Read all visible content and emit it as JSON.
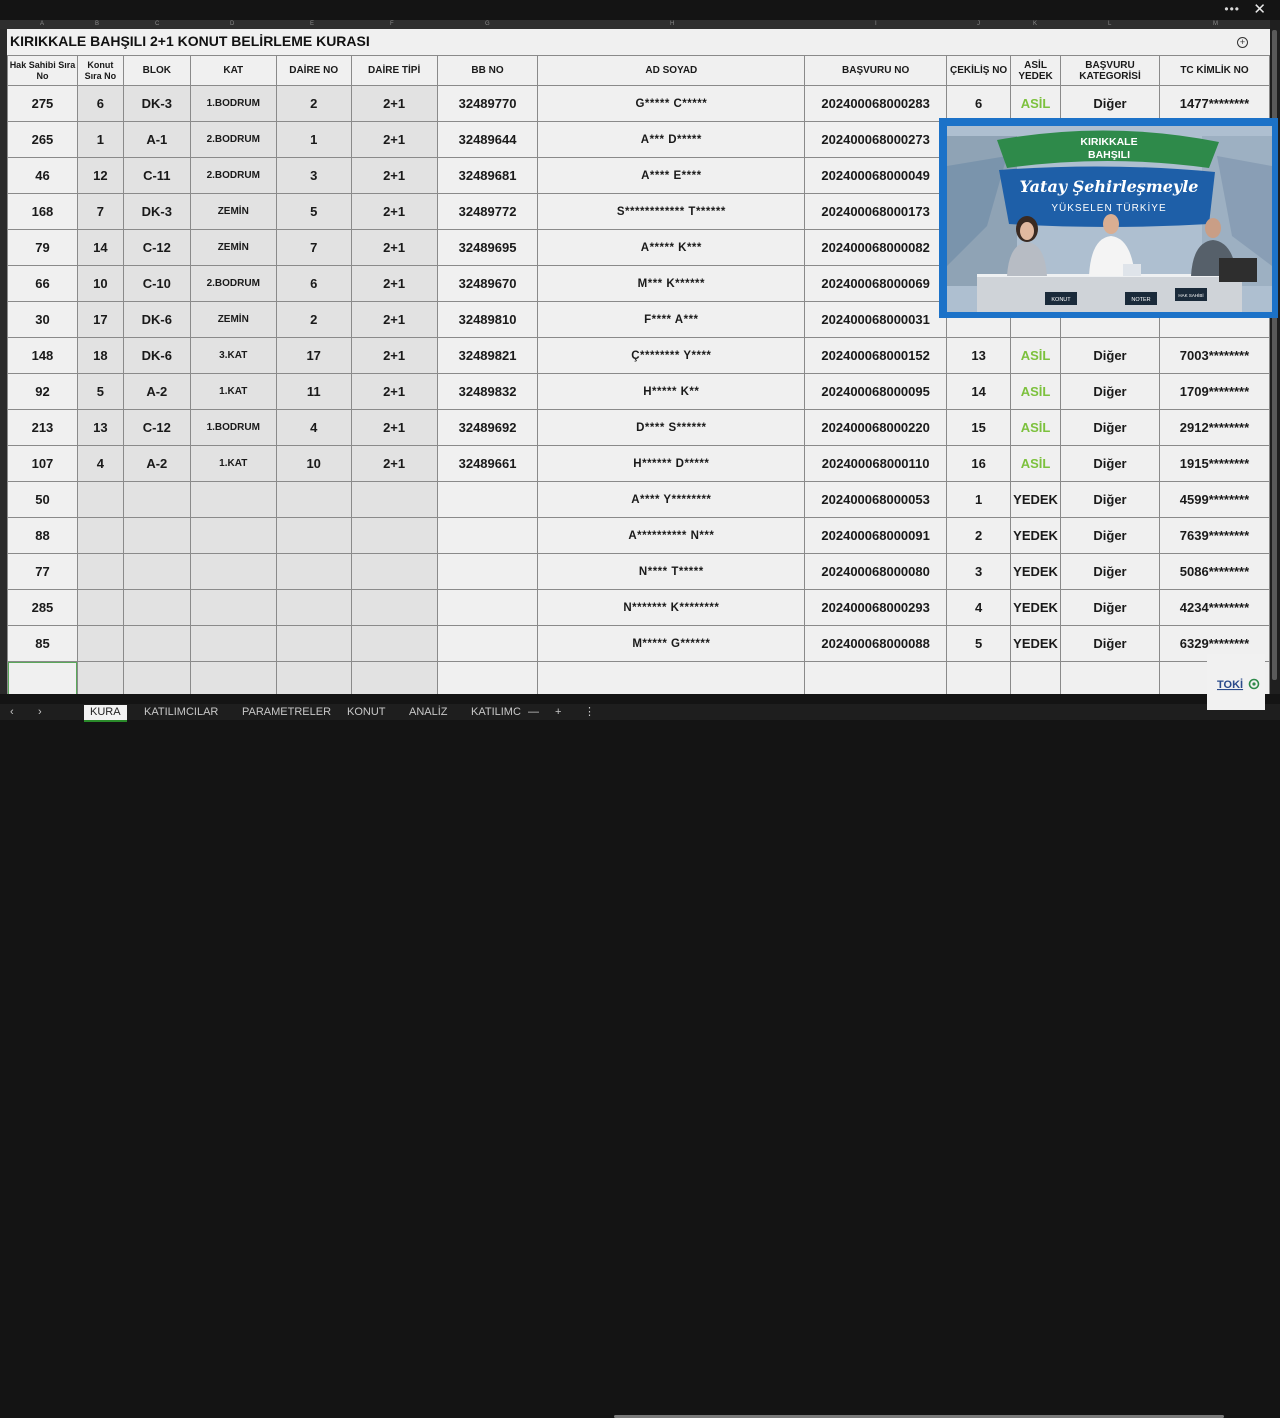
{
  "window": {
    "more": "•••",
    "close": "✕"
  },
  "col_letters": [
    "A",
    "B",
    "C",
    "D",
    "E",
    "F",
    "G",
    "H",
    "I",
    "J",
    "K",
    "L",
    "M"
  ],
  "title": "KIRIKKALE BAHŞILI 2+1 KONUT BELİRLEME KURASI",
  "headers": [
    "Hak Sahibi Sıra No",
    "Konut Sıra No",
    "BLOK",
    "KAT",
    "DAİRE NO",
    "DAİRE TİPİ",
    "BB NO",
    "AD SOYAD",
    "BAŞVURU NO",
    "ÇEKİLİŞ NO",
    "ASİL YEDEK",
    "BAŞVURU KATEGORİSİ",
    "TC KİMLİK NO"
  ],
  "rows": [
    [
      "275",
      "6",
      "DK-3",
      "1.BODRUM",
      "2",
      "2+1",
      "32489770",
      "G***** C*****",
      "202400068000283",
      "6",
      "ASİL",
      "Diğer",
      "1477********"
    ],
    [
      "265",
      "1",
      "A-1",
      "2.BODRUM",
      "1",
      "2+1",
      "32489644",
      "A*** D*****",
      "202400068000273",
      "",
      "",
      "",
      ""
    ],
    [
      "46",
      "12",
      "C-11",
      "2.BODRUM",
      "3",
      "2+1",
      "32489681",
      "A**** E****",
      "202400068000049",
      "",
      "",
      "",
      ""
    ],
    [
      "168",
      "7",
      "DK-3",
      "ZEMİN",
      "5",
      "2+1",
      "32489772",
      "S************ T******",
      "202400068000173",
      "",
      "",
      "",
      ""
    ],
    [
      "79",
      "14",
      "C-12",
      "ZEMİN",
      "7",
      "2+1",
      "32489695",
      "A***** K***",
      "202400068000082",
      "",
      "",
      "",
      ""
    ],
    [
      "66",
      "10",
      "C-10",
      "2.BODRUM",
      "6",
      "2+1",
      "32489670",
      "M*** K******",
      "202400068000069",
      "",
      "",
      "",
      ""
    ],
    [
      "30",
      "17",
      "DK-6",
      "ZEMİN",
      "2",
      "2+1",
      "32489810",
      "F**** A***",
      "202400068000031",
      "",
      "",
      "",
      ""
    ],
    [
      "148",
      "18",
      "DK-6",
      "3.KAT",
      "17",
      "2+1",
      "32489821",
      "Ç******** Y****",
      "202400068000152",
      "13",
      "ASİL",
      "Diğer",
      "7003********"
    ],
    [
      "92",
      "5",
      "A-2",
      "1.KAT",
      "11",
      "2+1",
      "32489832",
      "H***** K**",
      "202400068000095",
      "14",
      "ASİL",
      "Diğer",
      "1709********"
    ],
    [
      "213",
      "13",
      "C-12",
      "1.BODRUM",
      "4",
      "2+1",
      "32489692",
      "D**** S******",
      "202400068000220",
      "15",
      "ASİL",
      "Diğer",
      "2912********"
    ],
    [
      "107",
      "4",
      "A-2",
      "1.KAT",
      "10",
      "2+1",
      "32489661",
      "H****** D*****",
      "202400068000110",
      "16",
      "ASİL",
      "Diğer",
      "1915********"
    ],
    [
      "50",
      "",
      "",
      "",
      "",
      "",
      "",
      "A**** Y********",
      "202400068000053",
      "1",
      "YEDEK",
      "Diğer",
      "4599********"
    ],
    [
      "88",
      "",
      "",
      "",
      "",
      "",
      "",
      "A********** N***",
      "202400068000091",
      "2",
      "YEDEK",
      "Diğer",
      "7639********"
    ],
    [
      "77",
      "",
      "",
      "",
      "",
      "",
      "",
      "N**** T*****",
      "202400068000080",
      "3",
      "YEDEK",
      "Diğer",
      "5086********"
    ],
    [
      "285",
      "",
      "",
      "",
      "",
      "",
      "",
      "N******* K********",
      "202400068000293",
      "4",
      "YEDEK",
      "Diğer",
      "4234********"
    ],
    [
      "85",
      "",
      "",
      "",
      "",
      "",
      "",
      "M***** G******",
      "202400068000088",
      "5",
      "YEDEK",
      "Diğer",
      "6329********"
    ],
    [
      "",
      "",
      "",
      "",
      "",
      "",
      "",
      "",
      "",
      "",
      "",
      "",
      ""
    ]
  ],
  "live": {
    "banner_line1": "KIRIKKALE",
    "banner_line2": "BAHŞILI",
    "slogan": "Yatay Şehirleşmeyle",
    "subslogan": "YÜKSELEN TÜRKİYE",
    "nameplates": [
      "KONUT",
      "NOTER",
      "HAK SAHİBİ"
    ]
  },
  "tabs": [
    "KURA",
    "KATILIMCILAR",
    "PARAMETRELER",
    "KONUT",
    "ANALİZ",
    "KATILIMC"
  ],
  "tab_controls": {
    "prev": "‹",
    "next": "›",
    "dash": "—",
    "add": "+",
    "more": "⋮"
  },
  "toki_logo": "TOKİ",
  "colors": {
    "asil": "#7cc13d",
    "accent_frame": "#1c72c8",
    "banner_green": "#2e8a4a",
    "banner_blue": "#1e5fa8"
  }
}
